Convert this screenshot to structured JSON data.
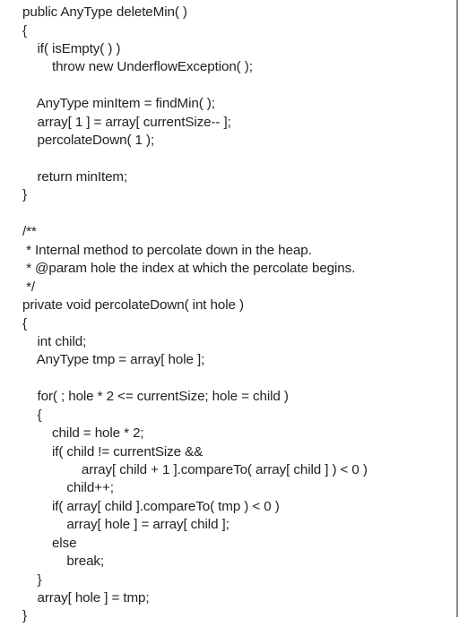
{
  "code": {
    "lines": [
      "public AnyType deleteMin( )",
      "{",
      "    if( isEmpty( ) )",
      "        throw new UnderflowException( );",
      "",
      "    AnyType minItem = findMin( );",
      "    array[ 1 ] = array[ currentSize-- ];",
      "    percolateDown( 1 );",
      "",
      "    return minItem;",
      "}",
      "",
      "/**",
      " * Internal method to percolate down in the heap.",
      " * @param hole the index at which the percolate begins.",
      " */",
      "private void percolateDown( int hole )",
      "{",
      "    int child;",
      "    AnyType tmp = array[ hole ];",
      "",
      "    for( ; hole * 2 <= currentSize; hole = child )",
      "    {",
      "        child = hole * 2;",
      "        if( child != currentSize &&",
      "                array[ child + 1 ].compareTo( array[ child ] ) < 0 )",
      "            child++;",
      "        if( array[ child ].compareTo( tmp ) < 0 )",
      "            array[ hole ] = array[ child ];",
      "        else",
      "            break;",
      "    }",
      "    array[ hole ] = tmp;",
      "}"
    ]
  }
}
